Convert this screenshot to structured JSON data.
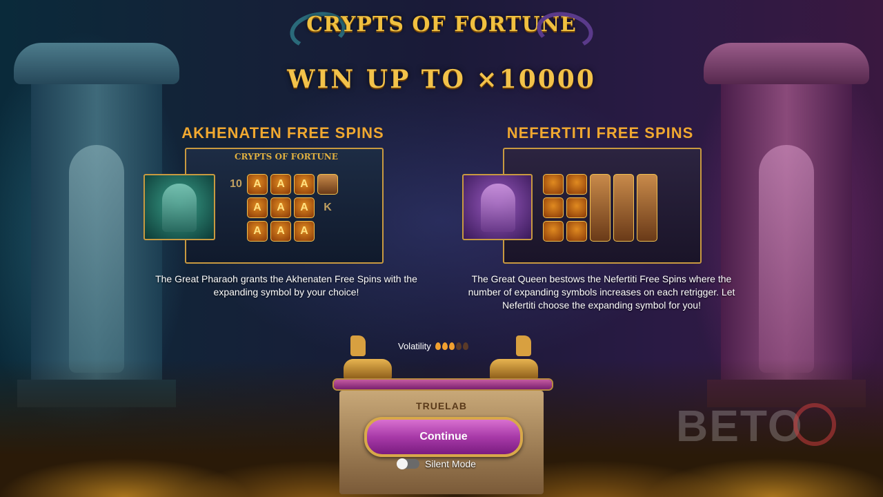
{
  "game": {
    "logo_text": "CRYPTS OF FORTUNE",
    "headline": "WIN UP TO ×10000"
  },
  "features": [
    {
      "title": "AKHENATEN FREE SPINS",
      "description": "The Great Pharaoh grants the Akhenaten Free Spins with the expanding symbol by your choice!",
      "preview": {
        "mini_logo": "CRYPTS OF FORTUNE",
        "row_labels": [
          "10",
          "",
          "K"
        ],
        "symbol": "A"
      }
    },
    {
      "title": "NEFERTITI FREE SPINS",
      "description": "The Great Queen bestows the Nefertiti Free Spins where the number of expanding symbols increases on each retrigger. Let Nefertiti choose the expanding symbol for you!"
    }
  ],
  "volatility": {
    "label": "Volatility",
    "level": 3,
    "max": 5
  },
  "progress_fraction": 1.0,
  "brand": "TRUELAB",
  "continue_label": "Continue",
  "silent_mode": {
    "label": "Silent Mode",
    "enabled": false
  },
  "watermark": "BETO",
  "colors": {
    "title_gold": "#f0a830",
    "button_purple": "#a83aa8",
    "button_border": "#d8a84a"
  }
}
